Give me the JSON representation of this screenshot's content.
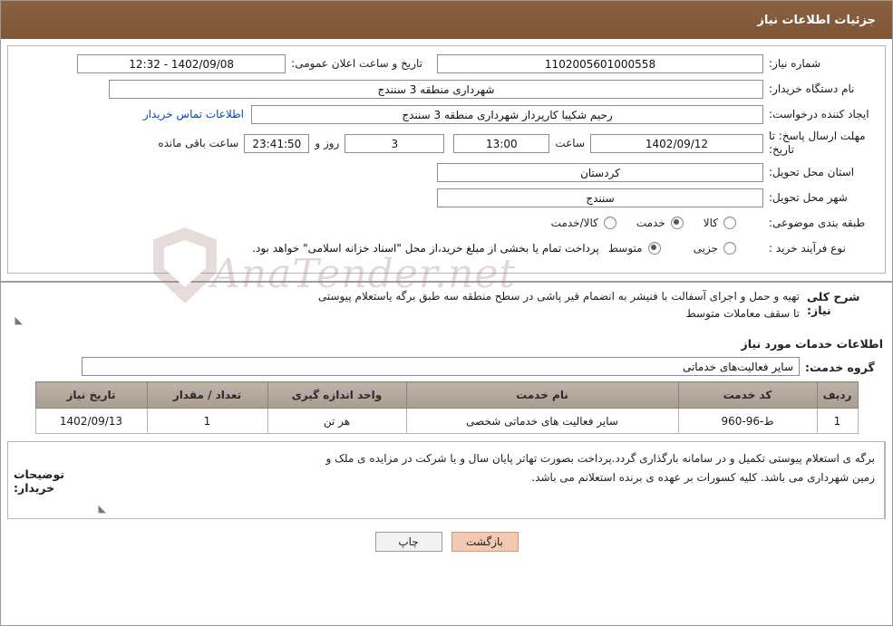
{
  "header": {
    "title": "جزئیات اطلاعات نیاز"
  },
  "form": {
    "need_number_label": "شماره نیاز:",
    "need_number_value": "1102005601000558",
    "public_announce_label": "تاریخ و ساعت اعلان عمومی:",
    "public_announce_value": "1402/09/08 - 12:32",
    "buyer_org_label": "نام دستگاه خریدار:",
    "buyer_org_value": "شهرداری منطقه 3 سنندج",
    "requester_label": "ایجاد کننده درخواست:",
    "requester_value": "رحیم شکیبا کارپرداز شهرداری منطقه 3 سنندج",
    "contact_link": "اطلاعات تماس خریدار",
    "deadline_label": "مهلت ارسال پاسخ: تا تاریخ:",
    "deadline_date": "1402/09/12",
    "hour_label": "ساعت",
    "deadline_time": "13:00",
    "days_value": "3",
    "days_label": "روز و",
    "countdown_value": "23:41:50",
    "remaining_label": "ساعت باقی مانده",
    "province_label": "استان محل تحویل:",
    "province_value": "کردستان",
    "city_label": "شهر محل تحویل:",
    "city_value": "سنندج",
    "category_label": "طبقه بندی موضوعی:",
    "category_options": [
      "کالا",
      "خدمت",
      "کالا/خدمت"
    ],
    "category_selected": "خدمت",
    "purchase_type_label": "نوع فرآیند خرید :",
    "purchase_options": [
      "جزیی",
      "متوسط"
    ],
    "purchase_selected": "متوسط",
    "purchase_note": "پرداخت تمام یا بخشی از مبلغ خرید،از محل \"اسناد خزانه اسلامی\" خواهد بود."
  },
  "general_desc": {
    "label": "شرح کلی نیاز:",
    "line1": "تهیه  و حمل و اجرای آسفالت با فنیشر به انضمام قیر پاشی در سطح منطقه سه طبق برگه یاستعلام پیوستی",
    "line2": "تا سقف معاملات متوسط"
  },
  "services_section": {
    "title": "اطلاعات خدمات مورد نیاز",
    "group_label": "گروه خدمت:",
    "group_value": "سایر فعالیت‌های خدماتی"
  },
  "table": {
    "columns": [
      "ردیف",
      "کد خدمت",
      "نام خدمت",
      "واحد اندازه گیری",
      "تعداد / مقدار",
      "تاریخ نیاز"
    ],
    "rows": [
      {
        "row": "1",
        "code": "ط-96-960",
        "name": "سایر فعالیت های خدماتی شخصی",
        "unit": "هر تن",
        "qty": "1",
        "date": "1402/09/13"
      }
    ]
  },
  "buyer_notes": {
    "label": "توضیحات خریدار:",
    "line1": "برگه ی استعلام پیوستی تکمیل و در سامانه بارگذاری گردد.پرداخت بصورت تهاتر پایان سال و یا شرکت در مزایده ی ملک و",
    "line2": "زمین شهرداری می باشد. کلیه کسورات بر عهده ی برنده استعلانم می باشد."
  },
  "footer": {
    "print_label": "چاپ",
    "back_label": "بازگشت"
  },
  "watermark": {
    "text": "AnaTender.net"
  },
  "colors": {
    "header_bg": "#8a5f3d",
    "table_header_bg": "#b2a79c",
    "link": "#0a49a8",
    "primary_button": "#f3c9b2"
  }
}
